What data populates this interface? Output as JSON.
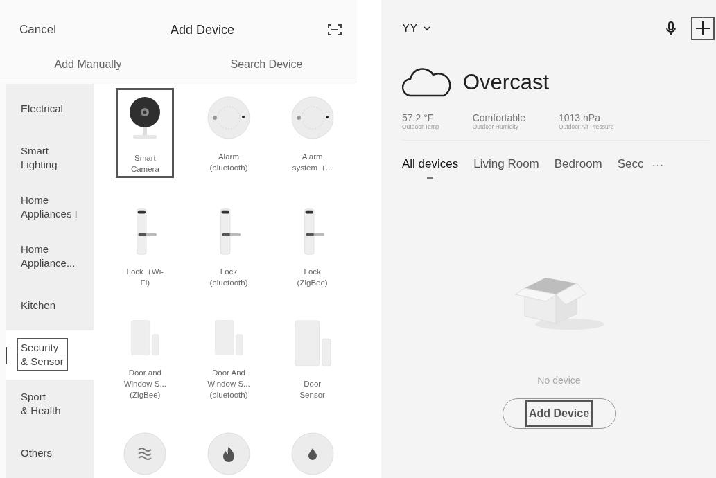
{
  "add_device_screen": {
    "cancel": "Cancel",
    "title": "Add Device",
    "tabs": [
      {
        "label": "Add Manually"
      },
      {
        "label": "Search Device"
      }
    ],
    "categories": [
      {
        "label": "Electrical",
        "selected": false,
        "highlighted": false
      },
      {
        "label": "Smart\nLighting",
        "selected": false,
        "highlighted": false
      },
      {
        "label": "Home\nAppliances I",
        "selected": false,
        "highlighted": false
      },
      {
        "label": "Home\nAppliance...",
        "selected": false,
        "highlighted": false
      },
      {
        "label": "Kitchen",
        "selected": false,
        "highlighted": false
      },
      {
        "label": "Security\n& Sensor",
        "selected": true,
        "highlighted": true
      },
      {
        "label": "Sport\n& Health",
        "selected": false,
        "highlighted": false
      },
      {
        "label": "Others",
        "selected": false,
        "highlighted": false
      }
    ],
    "devices": [
      {
        "kind": "camera",
        "label": "Smart\nCamera",
        "highlighted": true
      },
      {
        "kind": "alarm",
        "label": "Alarm\n(bluetooth)",
        "highlighted": false
      },
      {
        "kind": "alarm",
        "label": "Alarm\nsystem（...",
        "highlighted": false
      },
      {
        "kind": "lock",
        "label": "Lock（Wi-\nFi)",
        "highlighted": false
      },
      {
        "kind": "lock",
        "label": "Lock\n(bluetooth)",
        "highlighted": false
      },
      {
        "kind": "lock",
        "label": "Lock\n(ZigBee)",
        "highlighted": false
      },
      {
        "kind": "door",
        "label": "Door and\nWindow S...\n(ZigBee)",
        "highlighted": false
      },
      {
        "kind": "door",
        "label": "Door And\nWindow S...\n(bluetooth)",
        "highlighted": false
      },
      {
        "kind": "door",
        "label": "Door\nSensor",
        "highlighted": false
      },
      {
        "kind": "waves",
        "highlighted": false
      },
      {
        "kind": "flame",
        "highlighted": false
      },
      {
        "kind": "drop",
        "highlighted": false
      }
    ]
  },
  "home_screen": {
    "home_name": "YY",
    "add_highlighted": true,
    "weather": "Overcast",
    "stats": [
      {
        "value": "57.2 °F",
        "label": "Outdoor Temp"
      },
      {
        "value": "Comfortable",
        "label": "Outdoor Humidity"
      },
      {
        "value": "1013 hPa",
        "label": "Outdoor Air Pressure"
      }
    ],
    "rooms": [
      {
        "label": "All devices",
        "selected": true
      },
      {
        "label": "Living Room",
        "selected": false
      },
      {
        "label": "Bedroom",
        "selected": false
      },
      {
        "label": "Secc",
        "selected": false
      }
    ],
    "more": "···",
    "empty_text": "No device",
    "add_button": {
      "label": "Add Device",
      "highlighted": true
    }
  }
}
